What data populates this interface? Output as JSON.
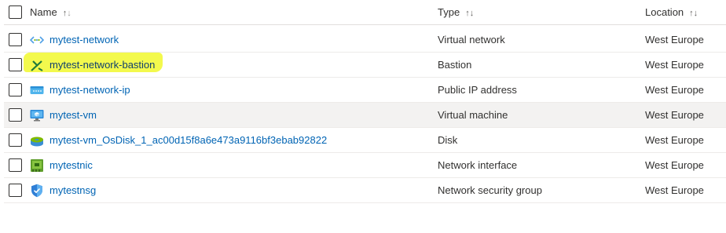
{
  "columns": {
    "name": "Name",
    "type": "Type",
    "location": "Location"
  },
  "sort_glyphs": {
    "name_up": "↑",
    "name_down": "↓",
    "type": "↑↓",
    "location": "↑↓"
  },
  "rows": [
    {
      "name": "mytest-network",
      "type": "Virtual network",
      "location": "West Europe",
      "icon": "virtual-network-icon",
      "highlighted": false
    },
    {
      "name": "mytest-network-bastion",
      "type": "Bastion",
      "location": "West Europe",
      "icon": "bastion-icon",
      "highlighted": true
    },
    {
      "name": "mytest-network-ip",
      "type": "Public IP address",
      "location": "West Europe",
      "icon": "public-ip-icon",
      "highlighted": false
    },
    {
      "name": "mytest-vm",
      "type": "Virtual machine",
      "location": "West Europe",
      "icon": "virtual-machine-icon",
      "highlighted": false
    },
    {
      "name": "mytest-vm_OsDisk_1_ac00d15f8a6e473a9116bf3ebab92822",
      "type": "Disk",
      "location": "West Europe",
      "icon": "disk-icon",
      "highlighted": false
    },
    {
      "name": "mytestnic",
      "type": "Network interface",
      "location": "West Europe",
      "icon": "network-interface-icon",
      "highlighted": false
    },
    {
      "name": "mytestnsg",
      "type": "Network security group",
      "location": "West Europe",
      "icon": "network-security-group-icon",
      "highlighted": false
    }
  ],
  "colors": {
    "link": "#0064b4",
    "highlight": "#f2f83a",
    "alt_row": "#f3f2f1"
  }
}
